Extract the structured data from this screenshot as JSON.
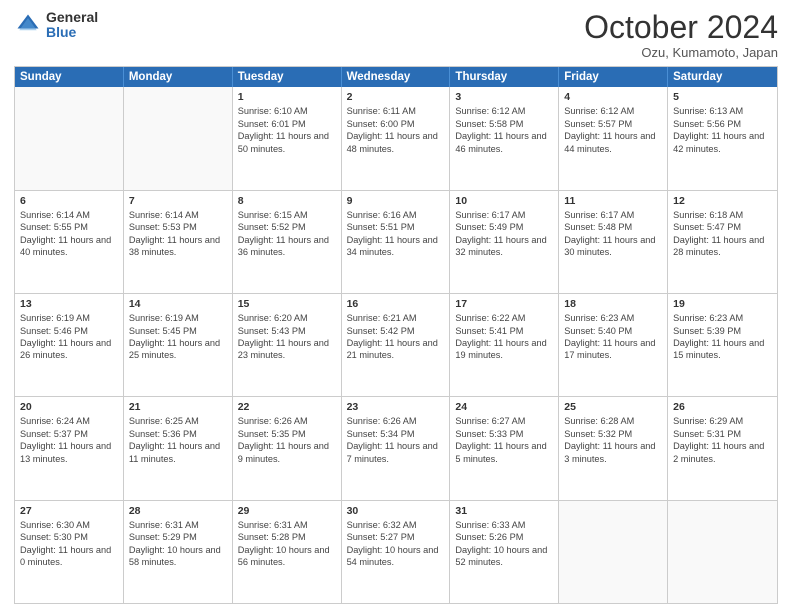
{
  "logo": {
    "general": "General",
    "blue": "Blue"
  },
  "title": {
    "month": "October 2024",
    "location": "Ozu, Kumamoto, Japan"
  },
  "header": {
    "days": [
      "Sunday",
      "Monday",
      "Tuesday",
      "Wednesday",
      "Thursday",
      "Friday",
      "Saturday"
    ]
  },
  "rows": [
    [
      {
        "day": "",
        "content": "",
        "empty": true
      },
      {
        "day": "",
        "content": "",
        "empty": true
      },
      {
        "day": "1",
        "content": "Sunrise: 6:10 AM\nSunset: 6:01 PM\nDaylight: 11 hours and 50 minutes."
      },
      {
        "day": "2",
        "content": "Sunrise: 6:11 AM\nSunset: 6:00 PM\nDaylight: 11 hours and 48 minutes."
      },
      {
        "day": "3",
        "content": "Sunrise: 6:12 AM\nSunset: 5:58 PM\nDaylight: 11 hours and 46 minutes."
      },
      {
        "day": "4",
        "content": "Sunrise: 6:12 AM\nSunset: 5:57 PM\nDaylight: 11 hours and 44 minutes."
      },
      {
        "day": "5",
        "content": "Sunrise: 6:13 AM\nSunset: 5:56 PM\nDaylight: 11 hours and 42 minutes."
      }
    ],
    [
      {
        "day": "6",
        "content": "Sunrise: 6:14 AM\nSunset: 5:55 PM\nDaylight: 11 hours and 40 minutes."
      },
      {
        "day": "7",
        "content": "Sunrise: 6:14 AM\nSunset: 5:53 PM\nDaylight: 11 hours and 38 minutes."
      },
      {
        "day": "8",
        "content": "Sunrise: 6:15 AM\nSunset: 5:52 PM\nDaylight: 11 hours and 36 minutes."
      },
      {
        "day": "9",
        "content": "Sunrise: 6:16 AM\nSunset: 5:51 PM\nDaylight: 11 hours and 34 minutes."
      },
      {
        "day": "10",
        "content": "Sunrise: 6:17 AM\nSunset: 5:49 PM\nDaylight: 11 hours and 32 minutes."
      },
      {
        "day": "11",
        "content": "Sunrise: 6:17 AM\nSunset: 5:48 PM\nDaylight: 11 hours and 30 minutes."
      },
      {
        "day": "12",
        "content": "Sunrise: 6:18 AM\nSunset: 5:47 PM\nDaylight: 11 hours and 28 minutes."
      }
    ],
    [
      {
        "day": "13",
        "content": "Sunrise: 6:19 AM\nSunset: 5:46 PM\nDaylight: 11 hours and 26 minutes."
      },
      {
        "day": "14",
        "content": "Sunrise: 6:19 AM\nSunset: 5:45 PM\nDaylight: 11 hours and 25 minutes."
      },
      {
        "day": "15",
        "content": "Sunrise: 6:20 AM\nSunset: 5:43 PM\nDaylight: 11 hours and 23 minutes."
      },
      {
        "day": "16",
        "content": "Sunrise: 6:21 AM\nSunset: 5:42 PM\nDaylight: 11 hours and 21 minutes."
      },
      {
        "day": "17",
        "content": "Sunrise: 6:22 AM\nSunset: 5:41 PM\nDaylight: 11 hours and 19 minutes."
      },
      {
        "day": "18",
        "content": "Sunrise: 6:23 AM\nSunset: 5:40 PM\nDaylight: 11 hours and 17 minutes."
      },
      {
        "day": "19",
        "content": "Sunrise: 6:23 AM\nSunset: 5:39 PM\nDaylight: 11 hours and 15 minutes."
      }
    ],
    [
      {
        "day": "20",
        "content": "Sunrise: 6:24 AM\nSunset: 5:37 PM\nDaylight: 11 hours and 13 minutes."
      },
      {
        "day": "21",
        "content": "Sunrise: 6:25 AM\nSunset: 5:36 PM\nDaylight: 11 hours and 11 minutes."
      },
      {
        "day": "22",
        "content": "Sunrise: 6:26 AM\nSunset: 5:35 PM\nDaylight: 11 hours and 9 minutes."
      },
      {
        "day": "23",
        "content": "Sunrise: 6:26 AM\nSunset: 5:34 PM\nDaylight: 11 hours and 7 minutes."
      },
      {
        "day": "24",
        "content": "Sunrise: 6:27 AM\nSunset: 5:33 PM\nDaylight: 11 hours and 5 minutes."
      },
      {
        "day": "25",
        "content": "Sunrise: 6:28 AM\nSunset: 5:32 PM\nDaylight: 11 hours and 3 minutes."
      },
      {
        "day": "26",
        "content": "Sunrise: 6:29 AM\nSunset: 5:31 PM\nDaylight: 11 hours and 2 minutes."
      }
    ],
    [
      {
        "day": "27",
        "content": "Sunrise: 6:30 AM\nSunset: 5:30 PM\nDaylight: 11 hours and 0 minutes."
      },
      {
        "day": "28",
        "content": "Sunrise: 6:31 AM\nSunset: 5:29 PM\nDaylight: 10 hours and 58 minutes."
      },
      {
        "day": "29",
        "content": "Sunrise: 6:31 AM\nSunset: 5:28 PM\nDaylight: 10 hours and 56 minutes."
      },
      {
        "day": "30",
        "content": "Sunrise: 6:32 AM\nSunset: 5:27 PM\nDaylight: 10 hours and 54 minutes."
      },
      {
        "day": "31",
        "content": "Sunrise: 6:33 AM\nSunset: 5:26 PM\nDaylight: 10 hours and 52 minutes."
      },
      {
        "day": "",
        "content": "",
        "empty": true
      },
      {
        "day": "",
        "content": "",
        "empty": true
      }
    ]
  ]
}
